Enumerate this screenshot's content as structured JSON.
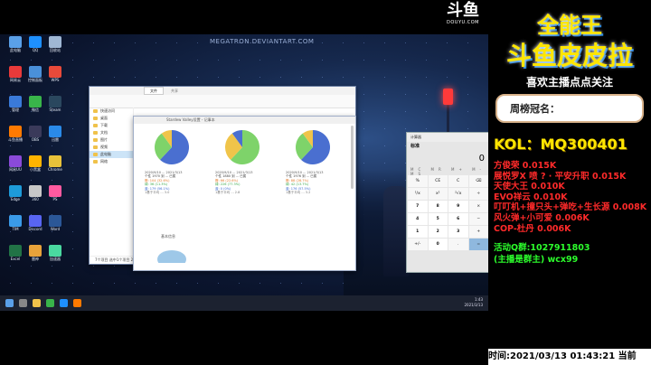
{
  "watermark": "MEGATRON.DEVIANTART.COM",
  "douyu": {
    "logo": "斗鱼",
    "url": "DOUYU.COM"
  },
  "desktop_icons": [
    {
      "label": "此电脑",
      "color": "#5aa0e8"
    },
    {
      "label": "QQ",
      "color": "#1e90ff"
    },
    {
      "label": "回收站",
      "color": "#9fb7d4"
    },
    {
      "label": "网易云",
      "color": "#e83a3a"
    },
    {
      "label": "控制面板",
      "color": "#4a90d9"
    },
    {
      "label": "WPS",
      "color": "#e84a3a"
    },
    {
      "label": "管理",
      "color": "#3a7ad9"
    },
    {
      "label": "微信",
      "color": "#39b54a"
    },
    {
      "label": "Steam",
      "color": "#2a475e"
    },
    {
      "label": "斗鱼直播",
      "color": "#ff7a00"
    },
    {
      "label": "OBS",
      "color": "#3a3a5a"
    },
    {
      "label": "迅雷",
      "color": "#2a8ae8"
    },
    {
      "label": "网易UU",
      "color": "#8a4ad9"
    },
    {
      "label": "小黑盒",
      "color": "#ffb400"
    },
    {
      "label": "Chrome",
      "color": "#e8c23a"
    },
    {
      "label": "Edge",
      "color": "#1e9bd9"
    },
    {
      "label": "360",
      "color": "#c8c8c8"
    },
    {
      "label": "PS",
      "color": "#ff5aa0"
    },
    {
      "label": "TIM",
      "color": "#3a9ae8"
    },
    {
      "label": "Discord",
      "color": "#5865f2"
    },
    {
      "label": "Word",
      "color": "#2b5797"
    },
    {
      "label": "Excel",
      "color": "#217346"
    },
    {
      "label": "雷神",
      "color": "#e8a23a"
    },
    {
      "label": "加速器",
      "color": "#4ad9a0"
    }
  ],
  "explorer": {
    "tab": "文件",
    "tab2": "共享",
    "nav": [
      "快速访问",
      "桌面",
      "下载",
      "文档",
      "图片",
      "视频",
      "此电脑",
      "网络"
    ],
    "selected_nav": 6,
    "status": "7个项目 选中1个项目 2.2 MB"
  },
  "note": {
    "title": "Stardew Valley设置 - 记事本",
    "panels": [
      {
        "label": "2020/9/10 ... 2021/3/13",
        "lines": [
          "个性 1970 到 ... 已属",
          "橙: 104 (32.6%)",
          "绿: 36 (11.3%)",
          "蓝: 179 (56.1%)",
          "1基于平均 ... 3.0"
        ],
        "colors": [
          "#4a6fd0",
          "#7ed36a",
          "#f0c44a"
        ]
      },
      {
        "label": "2020/9/10 ... 2021/3/13",
        "lines": [
          "个性 1880 到 ... 已属",
          "橙: 66 (22.6%)",
          "绿: 226 (77.3%)",
          "蓝: 0 (0%)",
          "1基于平均 ... 2.8"
        ],
        "colors": [
          "#7ed36a",
          "#f0c44a",
          "#4a6fd0"
        ]
      },
      {
        "label": "2020/9/10 ... 2021/3/13",
        "lines": [
          "个性 1976 到 ... 已属",
          "橙: 88 (28.7%)",
          "绿: 42 (13.7%)",
          "蓝: 176 (57.5%)",
          "1基于平均 ... 3.2"
        ],
        "colors": [
          "#4a6fd0",
          "#7ed36a",
          "#f0c44a"
        ]
      }
    ],
    "lower_title": "基本信息"
  },
  "calc": {
    "title": "计算器",
    "mode": "标准",
    "display": "0",
    "memory": "MC MR M+ M- MS",
    "keys": [
      "%",
      "CE",
      "C",
      "⌫",
      "¹/x",
      "x²",
      "²√x",
      "÷",
      "7",
      "8",
      "9",
      "×",
      "4",
      "5",
      "6",
      "−",
      "1",
      "2",
      "3",
      "+",
      "+/-",
      "0",
      ".",
      "="
    ]
  },
  "taskbar": {
    "time": "1:43",
    "date": "2021/3/13"
  },
  "side": {
    "title1": "全能王",
    "title2": "斗鱼皮皮拉",
    "title3": "喜欢主播点点关注",
    "crown": "周榜冠名：",
    "kol": "KOL：MQ300401",
    "donors": [
      "方俊荣 0.015K",
      "展悦罗X 喷 ? · 平安升职 0.015K",
      "天使大王 0.010K",
      "EVO祥云 0.010K",
      "叮叮机+撞只头+弹吃+生长源 0.008K",
      "风火弹+小可爱 0.006K",
      "COP-杜丹 0.006K"
    ],
    "group": [
      "活动Q群:1027911803",
      "(主播是群主) wcx99"
    ],
    "timebar": "时间:2021/03/13 01:43:21  当前"
  }
}
